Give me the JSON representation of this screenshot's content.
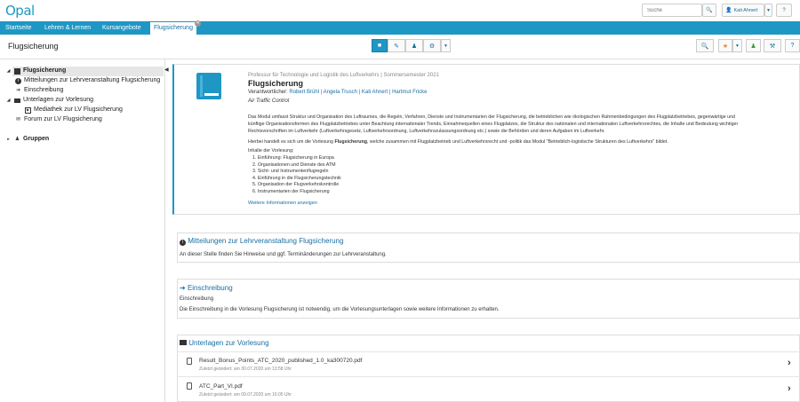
{
  "header": {
    "logo": "Opal",
    "search_placeholder": "Suche",
    "user_name": "Kati Ahnert",
    "help_label": "?"
  },
  "nav": {
    "items": [
      "Startseite",
      "Lehren & Lernen",
      "Kursangebote"
    ],
    "active_tab": "Flugsicherung"
  },
  "course": {
    "title": "Flugsicherung"
  },
  "sidebar": {
    "items": [
      {
        "label": "Flugsicherung"
      },
      {
        "label": "Mitteilungen zur Lehrveranstaltung Flugsicherung"
      },
      {
        "label": "Einschreibung"
      },
      {
        "label": "Unterlagen zur Vorlesung"
      },
      {
        "label": "Mediathek zur LV Flugsicherung"
      },
      {
        "label": "Forum zur LV Flugsicherung"
      },
      {
        "label": "Gruppen"
      }
    ]
  },
  "main": {
    "org_line": "Professur für Technologie und Logistik des Luftverkehrs | Sommersemester 2021",
    "title": "Flugsicherung",
    "responsible_label": "Verantwortlicher:",
    "responsibles": "Robert Brühl | Angela Trusch | Kati Ahnert | Hartmut Fricke",
    "subtitle": "Air Traffic Control",
    "desc1": "Das Modul umfasst Struktur und Organisation des Luftraumes, die Regeln, Verfahren, Dienste und Instrumentarien der Flugsicherung, die betrieblichen wie ökologischen Rahmenbedingungen des Flugplatzbetriebes, gegenwärtige und",
    "desc2": "künftige Organisationsformen des Flugplatzbetriebes unter Beachtung internationaler Trends, Einnahmequellen eines Flugplatzes, die Struktur des nationalen und internationalen Luftverkehrsrechtes, die Inhalte und Bedeutung wichtiger",
    "desc3": "Rechtsvorschriften im Luftverkehr (Luftverkehrsgesetz, Luftverkehrsordnung, Luftverkehrszulassungsordnung etc.) sowie die Behörden und deren Aufgaben im Luftverkehr.",
    "desc4_pre": "Hierbei handelt es sich um die Vorlesung ",
    "desc4_bold": "Flugsicherung",
    "desc4_post": ", welche zusammen mit Flugplatzbetrieb und Luftverkehrsrecht und -politik das Modul \"Betrieblich-logistische Strukturen des Luftverkehrs\" bildet.",
    "contents_label": "Inhalte der Vorlesung:",
    "contents": [
      "1. Einführung: Flugsicherung in Europa",
      "2. Organisationen und Dienste des ATM",
      "3. Sicht- und Instrumentenflugregeln",
      "4. Einführung in die Flugsicherungstechnik",
      "5. Organisation der Flugverkehrskontrolle",
      "6. Instrumentarien der Flugsicherung"
    ],
    "more_link": "Weitere Informationen anzeigen"
  },
  "sections": {
    "mitteilungen": {
      "title": "Mitteilungen zur Lehrveranstaltung Flugsicherung",
      "text": "An dieser Stelle finden Sie Hinweise und ggf. Terminänderungen zur Lehrveranstaltung."
    },
    "einschreibung": {
      "title": "Einschreibung",
      "subtitle": "Einschreibung",
      "text": "Die Einschreibung in die Vorlesung Flugsicherung ist notwendig, um die Vorlesungsunterlagen sowie weitere Informationen zu erhalten."
    },
    "unterlagen": {
      "title": "Unterlagen zur Vorlesung",
      "files": [
        {
          "name": "Result_Bonus_Points_ATC_2020_published_1.0_ka300720.pdf",
          "changed": "Zuletzt geändert: am 30.07.2020 um 13:58 Uhr"
        },
        {
          "name": "ATC_Part_VI.pdf",
          "changed": "Zuletzt geändert: am 09.07.2020 um 16:05 Uhr"
        }
      ]
    }
  }
}
